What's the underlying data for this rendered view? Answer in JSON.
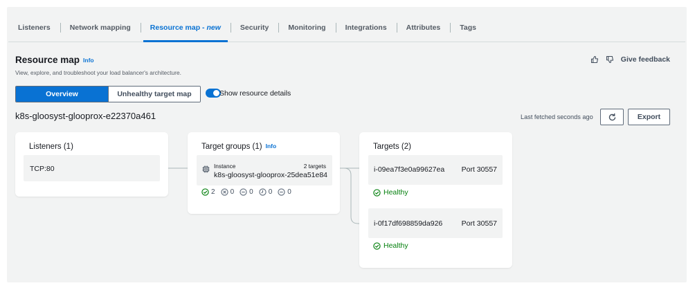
{
  "tabs": [
    {
      "label": "Listeners"
    },
    {
      "label": "Network mapping"
    },
    {
      "label": "Resource map - ",
      "suffix": "new",
      "active": true
    },
    {
      "label": "Security"
    },
    {
      "label": "Monitoring"
    },
    {
      "label": "Integrations"
    },
    {
      "label": "Attributes"
    },
    {
      "label": "Tags"
    }
  ],
  "header": {
    "title": "Resource map",
    "info": "Info",
    "description": "View, explore, and troubleshoot your load balancer's architecture.",
    "feedback": "Give feedback"
  },
  "view_toggle": {
    "overview": "Overview",
    "unhealthy": "Unhealthy target map",
    "selected": "Overview"
  },
  "details_toggle": {
    "label": "Show resource details",
    "on": true
  },
  "load_balancer": {
    "name": "k8s-gloosyst-glooprox-e22370a461"
  },
  "toolbar": {
    "fetched": "Last fetched seconds ago",
    "export": "Export"
  },
  "listeners": {
    "title": "Listeners (1)",
    "items": [
      "TCP:80"
    ]
  },
  "target_groups": {
    "title": "Target groups (1)",
    "info": "Info",
    "type": "Instance",
    "count": "2 targets",
    "name": "k8s-gloosyst-glooprox-25dea51e84",
    "stats": [
      "2",
      "0",
      "0",
      "0",
      "0"
    ]
  },
  "targets": {
    "title": "Targets (2)",
    "items": [
      {
        "id": "i-09ea7f3e0a99627ea",
        "port": "Port 30557",
        "status": "Healthy"
      },
      {
        "id": "i-0f17df698859da926",
        "port": "Port 30557",
        "status": "Healthy"
      }
    ]
  },
  "colors": {
    "accent": "#0972d3",
    "healthy": "#037f0c",
    "background": "#f2f3f3"
  }
}
